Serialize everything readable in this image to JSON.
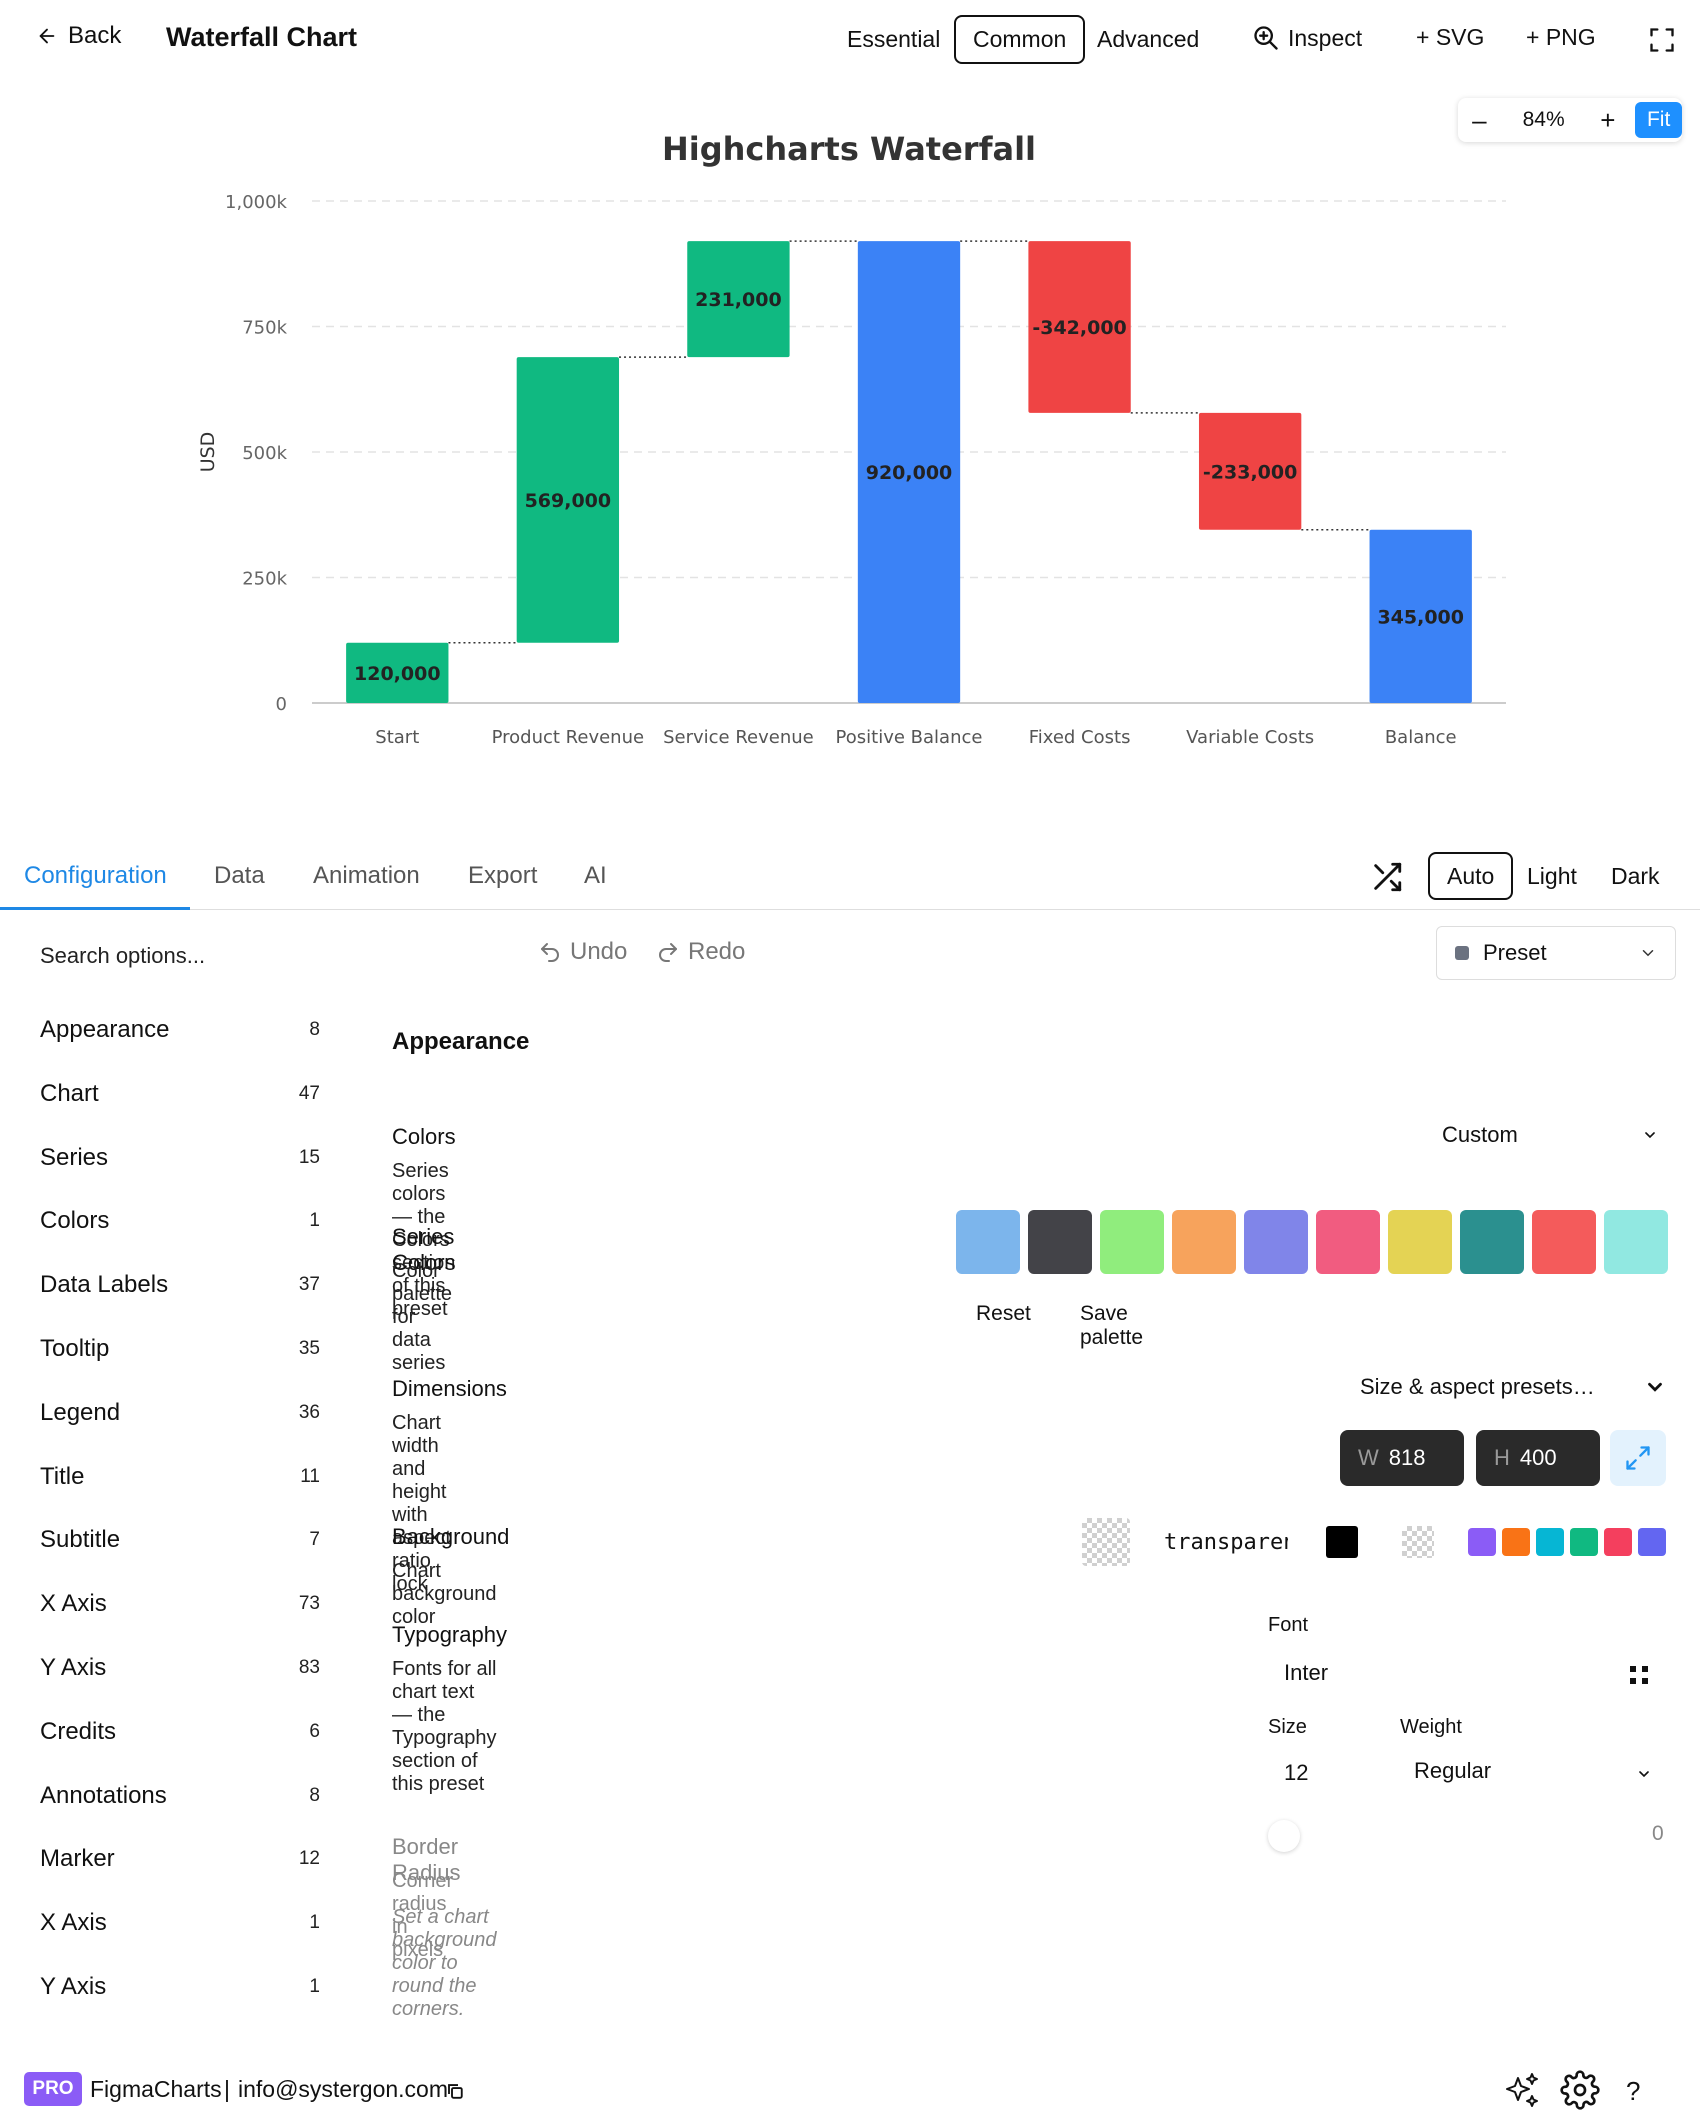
{
  "topbar": {
    "back_label": "Back",
    "title": "Waterfall Chart",
    "tiers": [
      "Essential",
      "Common",
      "Advanced"
    ],
    "active_tier": "Common",
    "inspect_label": "Inspect",
    "svg_label": "+ SVG",
    "png_label": "+ PNG"
  },
  "zoom": {
    "minus": "–",
    "value": "84%",
    "plus": "+",
    "fit": "Fit"
  },
  "chart_data": {
    "type": "waterfall",
    "title": "Highcharts Waterfall",
    "ylabel": "USD",
    "ylim": [
      0,
      1000000
    ],
    "y_ticks": [
      "0",
      "250k",
      "500k",
      "750k",
      "1,000k"
    ],
    "categories": [
      "Start",
      "Product Revenue",
      "Service Revenue",
      "Positive Balance",
      "Fixed Costs",
      "Variable Costs",
      "Balance"
    ],
    "values": [
      120000,
      569000,
      231000,
      920000,
      -342000,
      -233000,
      345000
    ],
    "labels": [
      "120,000",
      "569,000",
      "231,000",
      "920,000",
      "-342,000",
      "-233,000",
      "345,000"
    ],
    "bar_types": [
      "increase",
      "increase",
      "increase",
      "sum",
      "decrease",
      "decrease",
      "sum"
    ],
    "colors": {
      "increase": "#10b981",
      "decrease": "#ef4444",
      "sum": "#3b82f6"
    },
    "grid": true
  },
  "tabs": {
    "items": [
      "Configuration",
      "Data",
      "Animation",
      "Export",
      "AI"
    ],
    "active": "Configuration",
    "modes": [
      "Auto",
      "Light",
      "Dark"
    ],
    "active_mode": "Auto"
  },
  "toolbar": {
    "search_placeholder": "Search options...",
    "undo": "Undo",
    "redo": "Redo",
    "preset": "Preset"
  },
  "sidebar": [
    {
      "label": "Appearance",
      "count": "8"
    },
    {
      "label": "Chart",
      "count": "47"
    },
    {
      "label": "Series",
      "count": "15"
    },
    {
      "label": "Colors",
      "count": "1"
    },
    {
      "label": "Data Labels",
      "count": "37"
    },
    {
      "label": "Tooltip",
      "count": "35"
    },
    {
      "label": "Legend",
      "count": "36"
    },
    {
      "label": "Title",
      "count": "11"
    },
    {
      "label": "Subtitle",
      "count": "7"
    },
    {
      "label": "X Axis",
      "count": "73"
    },
    {
      "label": "Y Axis",
      "count": "83"
    },
    {
      "label": "Credits",
      "count": "6"
    },
    {
      "label": "Annotations",
      "count": "8"
    },
    {
      "label": "Marker",
      "count": "12"
    },
    {
      "label": "X Axis",
      "count": "1"
    },
    {
      "label": "Y Axis",
      "count": "1"
    }
  ],
  "main": {
    "section_title": "Appearance",
    "colors": {
      "title": "Colors",
      "desc": "Series colors — the Colors section of this preset",
      "value": "Custom"
    },
    "series_colors": {
      "title": "Series Colors",
      "desc": "Color palette for data series",
      "palette": [
        "#7cb5ec",
        "#434348",
        "#90ed7d",
        "#f7a35c",
        "#8085e9",
        "#f15c80",
        "#e4d354",
        "#2b908f",
        "#f45b5b",
        "#91e8e1"
      ],
      "reset": "Reset",
      "save": "Save palette"
    },
    "dimensions": {
      "title": "Dimensions",
      "desc": "Chart width and height with aspect ratio lock",
      "presets": "Size & aspect presets…",
      "w_label": "W",
      "w_value": "818",
      "h_label": "H",
      "h_value": "400"
    },
    "background": {
      "title": "Background",
      "desc": "Chart background color",
      "value": "transparent",
      "quick_colors": [
        "#8b5cf6",
        "#f97316",
        "#06b6d4",
        "#10b981",
        "#f43f5e",
        "#6366f1"
      ]
    },
    "typography": {
      "title": "Typography",
      "desc": "Fonts for all chart text — the Typography section of this preset",
      "font_label": "Font",
      "font_value": "Inter",
      "size_label": "Size",
      "size_value": "12",
      "weight_label": "Weight",
      "weight_value": "Regular"
    },
    "border_radius": {
      "title": "Border Radius",
      "desc": "Corner radius in pixels",
      "hint": "Set a chart background color to round the corners.",
      "value": "0"
    }
  },
  "footer": {
    "badge": "PRO",
    "brand": "FigmaCharts",
    "separator": "|",
    "email": "info@systergon.com",
    "help": "?"
  }
}
